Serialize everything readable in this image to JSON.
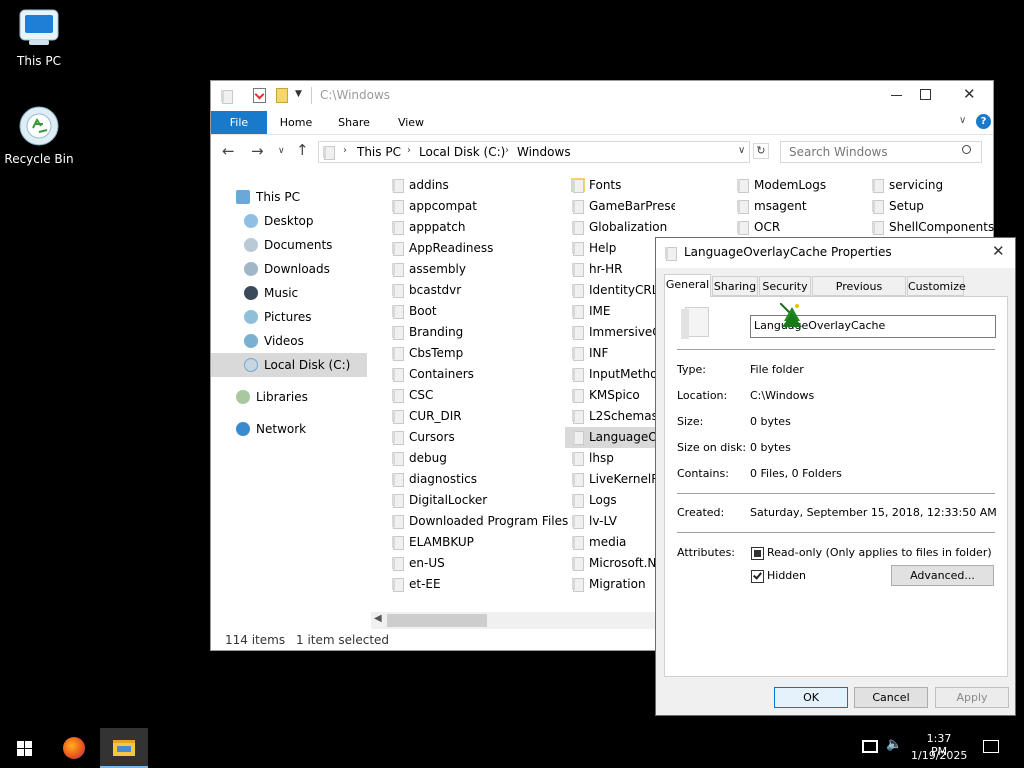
{
  "desktop": {
    "icons": [
      {
        "label": "This PC"
      },
      {
        "label": "Recycle Bin"
      }
    ]
  },
  "explorer": {
    "title_path": "C:\\Windows",
    "ribbon": {
      "file": "File",
      "home": "Home",
      "share": "Share",
      "view": "View"
    },
    "address": {
      "crumbs": [
        "This PC",
        "Local Disk (C:)",
        "Windows"
      ]
    },
    "search_placeholder": "Search Windows",
    "nav": {
      "this_pc": "This PC",
      "desktop": "Desktop",
      "documents": "Documents",
      "downloads": "Downloads",
      "music": "Music",
      "pictures": "Pictures",
      "videos": "Videos",
      "local_disk": "Local Disk (C:)",
      "libraries": "Libraries",
      "network": "Network"
    },
    "columns": [
      [
        "addins",
        "appcompat",
        "apppatch",
        "AppReadiness",
        "assembly",
        "bcastdvr",
        "Boot",
        "Branding",
        "CbsTemp",
        "Containers",
        "CSC",
        "CUR_DIR",
        "Cursors",
        "debug",
        "diagnostics",
        "DigitalLocker",
        "Downloaded Program Files",
        "ELAMBKUP",
        "en-US",
        "et-EE"
      ],
      [
        "Fonts",
        "GameBarPresenceWriter",
        "Globalization",
        "Help",
        "hr-HR",
        "IdentityCRL",
        "IME",
        "ImmersiveCo",
        "INF",
        "InputMethod",
        "KMSpico",
        "L2Schemas",
        "LanguageOve",
        "lhsp",
        "LiveKernelRe",
        "Logs",
        "lv-LV",
        "media",
        "Microsoft.NE",
        "Migration"
      ],
      [
        "ModemLogs",
        "msagent",
        "OCR"
      ],
      [
        "servicing",
        "Setup",
        "ShellComponents"
      ]
    ],
    "status": {
      "items": "114 items",
      "selected": "1 item selected"
    }
  },
  "dialog": {
    "title": "LanguageOverlayCache Properties",
    "tabs": [
      "General",
      "Sharing",
      "Security",
      "Previous Versions",
      "Customize"
    ],
    "name_value": "LanguageOverlayCache",
    "props": {
      "type_label": "Type:",
      "type_value": "File folder",
      "location_label": "Location:",
      "location_value": "C:\\Windows",
      "size_label": "Size:",
      "size_value": "0 bytes",
      "size_on_disk_label": "Size on disk:",
      "size_on_disk_value": "0 bytes",
      "contains_label": "Contains:",
      "contains_value": "0 Files, 0 Folders",
      "created_label": "Created:",
      "created_value": "Saturday, September 15, 2018, 12:33:50 AM",
      "attributes_label": "Attributes:"
    },
    "readonly_label": "Read-only (Only applies to files in folder)",
    "hidden_label": "Hidden",
    "hidden_checked": true,
    "advanced_button": "Advanced...",
    "ok_button": "OK",
    "cancel_button": "Cancel",
    "apply_button": "Apply"
  },
  "taskbar": {
    "time": "1:37 PM",
    "date": "1/19/2025"
  },
  "colors": {
    "accent": "#1979ca",
    "selection": "#cce8ff",
    "nav_selected": "#d9d9d9"
  }
}
